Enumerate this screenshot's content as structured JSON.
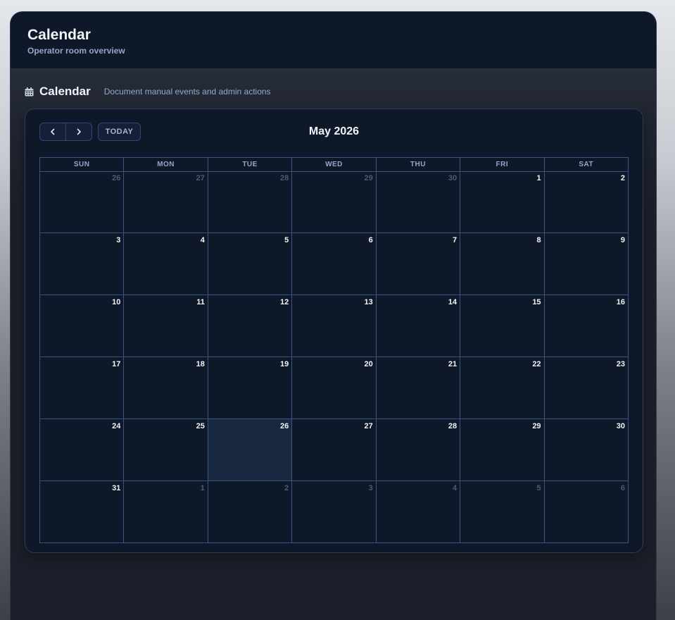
{
  "header": {
    "title": "Calendar",
    "subtitle": "Operator room overview"
  },
  "section": {
    "icon": "calendar-icon",
    "title": "Calendar",
    "description": "Document manual events and admin actions"
  },
  "toolbar": {
    "prev_icon": "chevron-left-icon",
    "next_icon": "chevron-right-icon",
    "today_label": "TODAY",
    "month_title": "May 2026"
  },
  "calendar": {
    "weekdays": [
      "SUN",
      "MON",
      "TUE",
      "WED",
      "THU",
      "FRI",
      "SAT"
    ],
    "weeks": [
      [
        {
          "n": "26",
          "other": true
        },
        {
          "n": "27",
          "other": true
        },
        {
          "n": "28",
          "other": true
        },
        {
          "n": "29",
          "other": true
        },
        {
          "n": "30",
          "other": true
        },
        {
          "n": "1"
        },
        {
          "n": "2"
        }
      ],
      [
        {
          "n": "3"
        },
        {
          "n": "4"
        },
        {
          "n": "5"
        },
        {
          "n": "6"
        },
        {
          "n": "7"
        },
        {
          "n": "8"
        },
        {
          "n": "9"
        }
      ],
      [
        {
          "n": "10"
        },
        {
          "n": "11"
        },
        {
          "n": "12"
        },
        {
          "n": "13"
        },
        {
          "n": "14"
        },
        {
          "n": "15"
        },
        {
          "n": "16"
        }
      ],
      [
        {
          "n": "17"
        },
        {
          "n": "18"
        },
        {
          "n": "19"
        },
        {
          "n": "20"
        },
        {
          "n": "21"
        },
        {
          "n": "22"
        },
        {
          "n": "23"
        }
      ],
      [
        {
          "n": "24"
        },
        {
          "n": "25"
        },
        {
          "n": "26",
          "today": true
        },
        {
          "n": "27"
        },
        {
          "n": "28"
        },
        {
          "n": "29"
        },
        {
          "n": "30"
        }
      ],
      [
        {
          "n": "31"
        },
        {
          "n": "1",
          "other": true
        },
        {
          "n": "2",
          "other": true
        },
        {
          "n": "3",
          "other": true
        },
        {
          "n": "4",
          "other": true
        },
        {
          "n": "5",
          "other": true
        },
        {
          "n": "6",
          "other": true
        }
      ]
    ]
  },
  "colors": {
    "background": "#1b1f29",
    "panel": "#0f1828",
    "today_highlight": "#172840",
    "grid_line": "#3a5680",
    "text_primary": "#f1f5f9",
    "text_muted": "#93a8c8",
    "text_other_month": "#4d5b72"
  }
}
